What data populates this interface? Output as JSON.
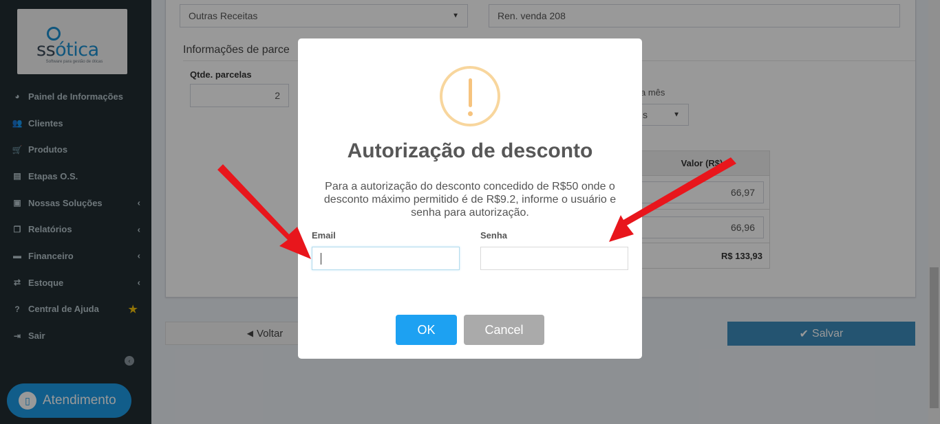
{
  "sidebar": {
    "logo": {
      "text_main": "ss",
      "text_accent": "ótica",
      "tagline": "Software para gestão de óticas"
    },
    "items": [
      {
        "label": "Painel de Informações",
        "icon": "dashboard-icon",
        "glyph": "◕"
      },
      {
        "label": "Clientes",
        "icon": "users-icon",
        "glyph": "👥"
      },
      {
        "label": "Produtos",
        "icon": "cart-icon",
        "glyph": "🛒"
      },
      {
        "label": "Etapas O.S.",
        "icon": "card-icon",
        "glyph": "▤"
      },
      {
        "label": "Nossas Soluções",
        "icon": "briefcase-icon",
        "glyph": "▣",
        "chevron": "‹"
      },
      {
        "label": "Relatórios",
        "icon": "copy-icon",
        "glyph": "❐",
        "chevron": "‹"
      },
      {
        "label": "Financeiro",
        "icon": "money-icon",
        "glyph": "▬",
        "chevron": "‹"
      },
      {
        "label": "Estoque",
        "icon": "exchange-icon",
        "glyph": "⇄",
        "chevron": "‹"
      },
      {
        "label": "Central de Ajuda",
        "icon": "question-icon",
        "glyph": "?",
        "star": "★"
      },
      {
        "label": "Sair",
        "icon": "sign-out-icon",
        "glyph": "⇥"
      }
    ],
    "collapse_glyph": "‹",
    "atendimento": {
      "label": "Atendimento",
      "glyph": "▯"
    }
  },
  "form": {
    "category_select": "Outras Receitas",
    "description_input": "Ren. venda 208",
    "section_title": "Informações de parce",
    "qtde_label": "Qtde. parcelas",
    "qtde_value": "2",
    "dia_label": "a mês",
    "dia_select": "s",
    "table_header_valor": "Valor (R$)",
    "parcela_values": [
      "66,97",
      "66,96"
    ],
    "total": "R$ 133,93",
    "voltar_label": "Voltar",
    "voltar_glyph": "◀",
    "salvar_label": "Salvar",
    "salvar_glyph": "✔"
  },
  "modal": {
    "title": "Autorização de desconto",
    "message": "Para a autorização do desconto concedido de R$50 onde o desconto máximo permitido é de R$9.2, informe o usuário e senha para autorização.",
    "email_label": "Email",
    "senha_label": "Senha",
    "ok_label": "OK",
    "cancel_label": "Cancel"
  },
  "colors": {
    "sidebar_bg": "#222d32",
    "accent_blue": "#1da1f2",
    "warning": "#f8bb86",
    "arrow_red": "#e8161c"
  }
}
